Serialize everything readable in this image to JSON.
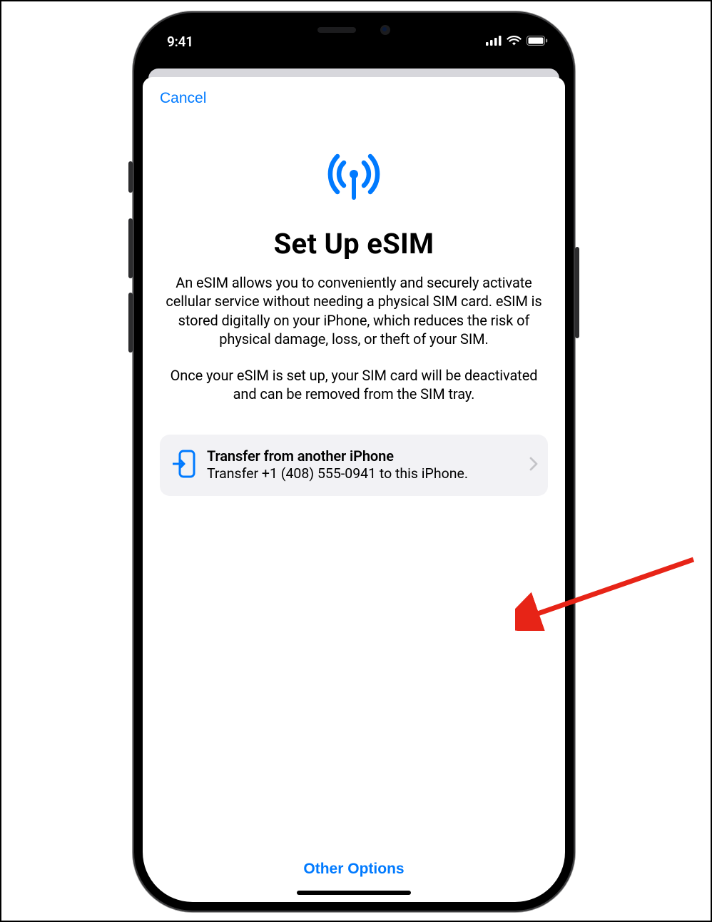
{
  "status": {
    "time": "9:41"
  },
  "nav": {
    "cancel": "Cancel"
  },
  "hero": {
    "title": "Set Up eSIM",
    "paragraph1": "An eSIM allows you to conveniently and securely activate cellular service without needing a physical SIM card. eSIM is stored digitally on your iPhone, which reduces the risk of physical damage, loss, or theft of your SIM.",
    "paragraph2": "Once your eSIM is set up, your SIM card will be deactivated and can be removed from the SIM tray."
  },
  "option": {
    "title": "Transfer from another iPhone",
    "subtitle": "Transfer +1 (408) 555-0941 to this iPhone."
  },
  "footer": {
    "other_options": "Other Options"
  },
  "colors": {
    "accent": "#007aff"
  }
}
